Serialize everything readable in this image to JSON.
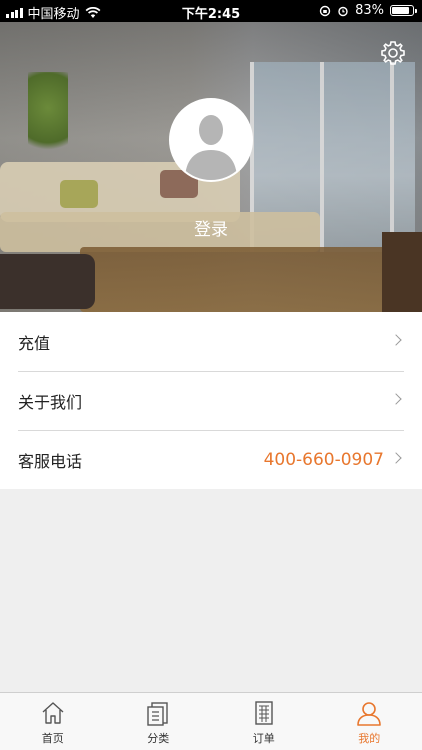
{
  "status_bar": {
    "carrier": "中国移动",
    "time": "下午2:45",
    "battery_percent": "83%",
    "battery_level": 0.83
  },
  "header": {
    "login_label": "登录",
    "settings_icon": "gear-icon",
    "avatar_icon": "user-silhouette-icon"
  },
  "menu": {
    "items": [
      {
        "label": "充值"
      },
      {
        "label": "关于我们"
      },
      {
        "label": "客服电话",
        "value": "400-660-0907"
      }
    ]
  },
  "tab_bar": {
    "tabs": [
      {
        "label": "首页",
        "icon": "home-icon"
      },
      {
        "label": "分类",
        "icon": "category-icon"
      },
      {
        "label": "订单",
        "icon": "order-icon"
      },
      {
        "label": "我的",
        "icon": "profile-icon",
        "active": true
      }
    ]
  },
  "colors": {
    "accent": "#e8772e",
    "background": "#efefef"
  }
}
